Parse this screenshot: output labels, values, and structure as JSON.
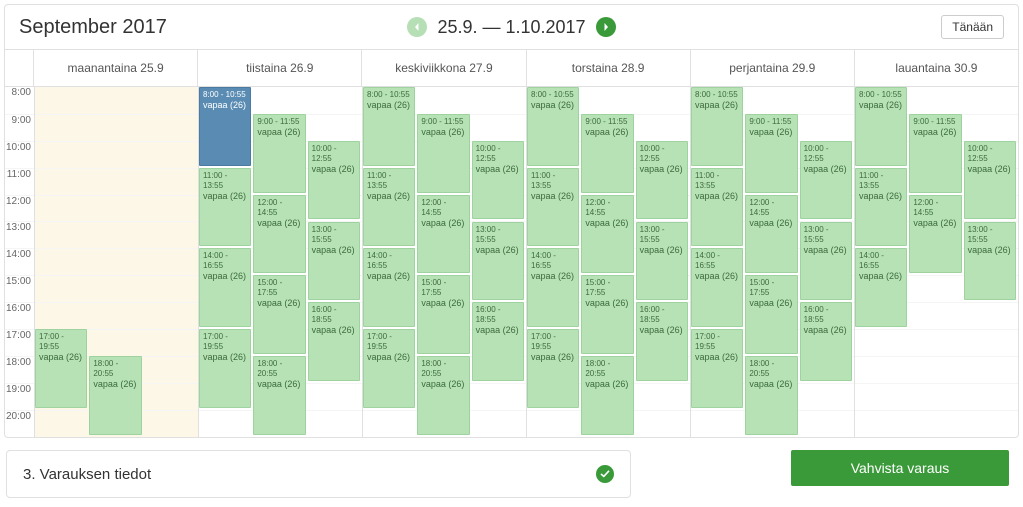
{
  "header": {
    "month_title": "September 2017",
    "date_range": "25.9. — 1.10.2017",
    "today_label": "Tänään"
  },
  "time_labels": [
    "8:00",
    "9:00",
    "10:00",
    "11:00",
    "12:00",
    "13:00",
    "14:00",
    "15:00",
    "16:00",
    "17:00",
    "18:00",
    "19:00",
    "20:00"
  ],
  "days": [
    {
      "label": "maanantaina 25.9",
      "is_monday": true
    },
    {
      "label": "tiistaina 26.9"
    },
    {
      "label": "keskiviikkona 27.9"
    },
    {
      "label": "torstaina 28.9"
    },
    {
      "label": "perjantaina 29.9"
    },
    {
      "label": "lauantaina 30.9"
    }
  ],
  "event_text": "vapaa (26)",
  "monday_events": [
    {
      "time": "17:00 - 19:55",
      "start": 9,
      "span": 3,
      "col": 0
    },
    {
      "time": "18:00 - 20:55",
      "start": 10,
      "span": 3,
      "col": 1
    }
  ],
  "day_events": [
    {
      "time": "8:00 - 10:55",
      "start": 0,
      "span": 3,
      "col": 0,
      "selected_on_tuesday": true
    },
    {
      "time": "9:00 - 11:55",
      "start": 1,
      "span": 3,
      "col": 1
    },
    {
      "time": "10:00 - 12:55",
      "start": 2,
      "span": 3,
      "col": 2
    },
    {
      "time": "11:00 - 13:55",
      "start": 3,
      "span": 3,
      "col": 0
    },
    {
      "time": "12:00 - 14:55",
      "start": 4,
      "span": 3,
      "col": 1
    },
    {
      "time": "13:00 - 15:55",
      "start": 5,
      "span": 3,
      "col": 2
    },
    {
      "time": "14:00 - 16:55",
      "start": 6,
      "span": 3,
      "col": 0
    },
    {
      "time": "15:00 - 17:55",
      "start": 7,
      "span": 3,
      "col": 1
    },
    {
      "time": "16:00 - 18:55",
      "start": 8,
      "span": 3,
      "col": 2
    },
    {
      "time": "17:00 - 19:55",
      "start": 9,
      "span": 3,
      "col": 0
    },
    {
      "time": "18:00 - 20:55",
      "start": 10,
      "span": 3,
      "col": 1
    }
  ],
  "saturday_omit_indices": [
    7,
    8,
    9,
    10
  ],
  "section": {
    "title": "3. Varauksen tiedot"
  },
  "confirm_label": "Vahvista varaus"
}
